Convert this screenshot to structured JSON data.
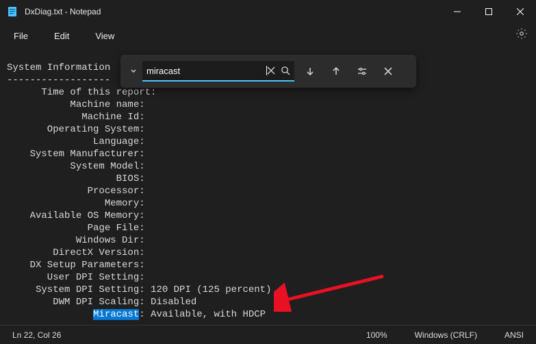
{
  "title_bar": {
    "title": "DxDiag.txt - Notepad"
  },
  "menu": {
    "file": "File",
    "edit": "Edit",
    "view": "View"
  },
  "find": {
    "query": "miracast"
  },
  "doc": {
    "heading": "System Information",
    "dashes": "------------------",
    "lines": {
      "time": "      Time of this report:",
      "mname": "           Machine name:",
      "mid": "             Machine Id:",
      "os": "       Operating System:",
      "lang": "               Language:",
      "sysmfr": "    System Manufacturer:",
      "sysmodel": "           System Model:",
      "bios": "                   BIOS:",
      "proc": "              Processor:",
      "mem": "                 Memory:",
      "availmem": "    Available OS Memory:",
      "pagefile": "              Page File:",
      "windir": "            Windows Dir:",
      "dxver": "        DirectX Version:",
      "dxsetup": "    DX Setup Parameters:",
      "userdpi": "       User DPI Setting:",
      "sysdpi_l": "     System DPI Setting: ",
      "sysdpi_v": "120 DPI (125 percent)",
      "dwm_l": "        DWM DPI Scaling: ",
      "dwm_v": "Disabled",
      "mira_pre": "               ",
      "mira_hl": "Miracast",
      "mira_post": ": Available, with HDCP"
    }
  },
  "status": {
    "pos": "Ln 22, Col 26",
    "zoom": "100%",
    "eol": "Windows (CRLF)",
    "enc": "ANSI"
  }
}
